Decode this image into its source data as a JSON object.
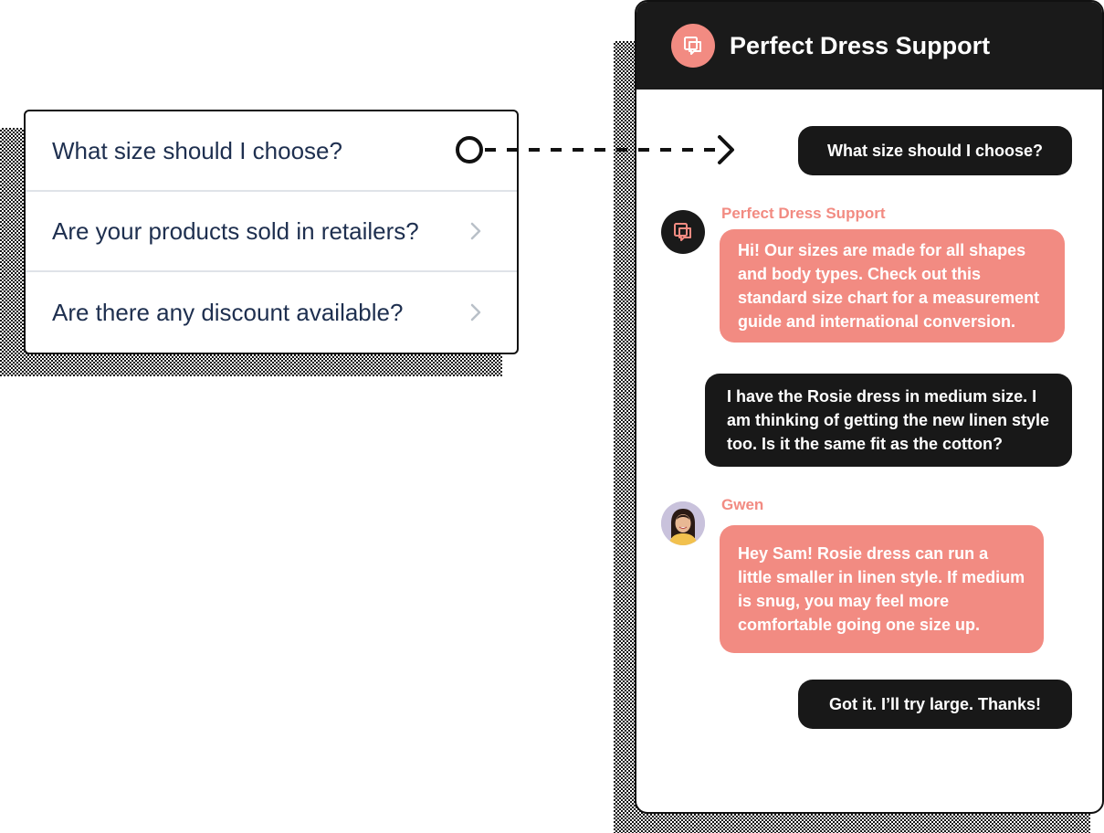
{
  "faq": {
    "items": [
      {
        "label": "What size should I choose?"
      },
      {
        "label": "Are your products sold in retailers?"
      },
      {
        "label": "Are there any discount available?"
      }
    ]
  },
  "chat": {
    "title": "Perfect Dress Support",
    "messages": [
      {
        "from": "user",
        "text": "What size should I choose?"
      },
      {
        "from": "agent",
        "sender": "Perfect Dress Support",
        "text": "Hi! Our sizes are made for all shapes and body types. Check out this standard size chart for a measurement guide and international conversion."
      },
      {
        "from": "user",
        "text": "I have the Rosie dress in medium size. I am thinking of getting the new linen style too. Is it the same fit as the cotton?"
      },
      {
        "from": "agent",
        "sender": "Gwen",
        "text": "Hey Sam! Rosie dress can run a little smaller in linen style. If medium is snug, you may feel more comfortable going one size up."
      },
      {
        "from": "user",
        "text": "Got it. I’ll try large. Thanks!"
      }
    ]
  },
  "colors": {
    "accent": "#f28b82",
    "dark": "#1a1a1a",
    "faq_text": "#1e2f4f"
  },
  "icons": [
    "chat-bubbles-icon",
    "chevron-right-icon",
    "avatar-photo"
  ]
}
